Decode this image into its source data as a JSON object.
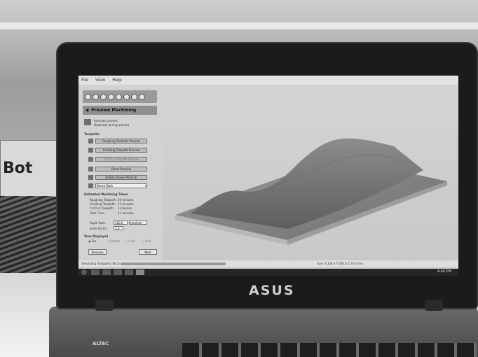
{
  "background": {
    "box_text": "Bot"
  },
  "laptop": {
    "brand": "ASUS",
    "base_brand": "ALTEC"
  },
  "app": {
    "menu": [
      "File",
      "View",
      "Help"
    ],
    "panel": {
      "title": "Preview Machining",
      "options": [
        "Animate preview",
        "Draw tool during preview"
      ],
      "toolpaths_heading": "Toolpaths",
      "buttons": {
        "roughing": "Roughing Toolpath Preview",
        "finishing": "Finishing Toolpath Preview",
        "cutout": "Cut Out Toolpath Preview",
        "reset": "Reset Preview",
        "material": "Delete Shown Material"
      },
      "material_select": "Beech Dark",
      "estimates_heading": "Estimated Machining Times",
      "estimates": [
        {
          "label": "Roughing Toolpath:",
          "value": "20 minutes"
        },
        {
          "label": "Finishing Toolpath:",
          "value": "13 minutes"
        },
        {
          "label": "Cut Out Toolpath:",
          "value": "3 minutes"
        },
        {
          "label": "Total Time:",
          "value": "41 minutes"
        }
      ],
      "rapid_rate_label": "Rapid Rate:",
      "rapid_rate_value": "100.0",
      "rapid_rate_unit": "mm/min",
      "scale_factor_label": "Scale Factor:",
      "scale_factor_value": "1.0",
      "view_heading": "View Displayed",
      "view_options": [
        "Top",
        "Bottom",
        "Front",
        "Side"
      ],
      "previous": "Previous",
      "next": "Next"
    },
    "status_text": "Simulating Toolpaths (Blitz)",
    "status_right": "Size: X 350.0 Y 200.0 Z 10.0 mm"
  },
  "taskbar": {
    "clock": "4:40 PM"
  }
}
